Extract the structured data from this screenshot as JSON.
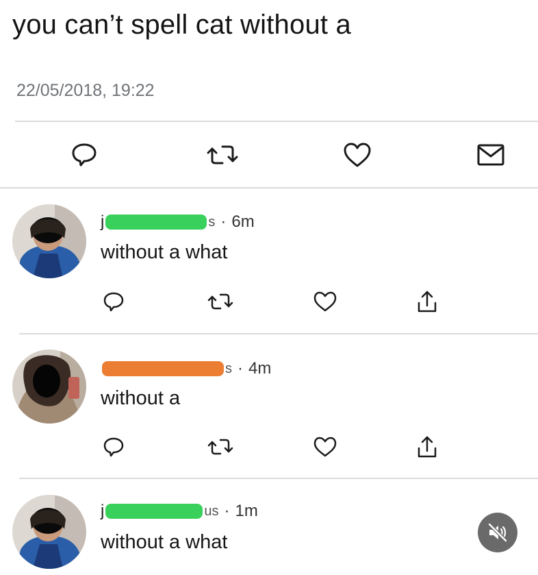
{
  "tweet": {
    "text": "you can’t spell cat without a",
    "timestamp": "22/05/2018, 19:22",
    "actions": {
      "reply_icon": "reply-icon",
      "retweet_icon": "retweet-icon",
      "like_icon": "heart-icon",
      "message_icon": "envelope-icon"
    }
  },
  "replies": [
    {
      "name_start": "j",
      "name_end": "s",
      "redaction_color": "#39d15b",
      "time": "6m",
      "text": "without a what"
    },
    {
      "name_start": "",
      "name_end": "s",
      "redaction_color": "#ec7e34",
      "time": "4m",
      "text": "without a"
    },
    {
      "name_start": "j",
      "name_end": "us",
      "redaction_color": "#39d15b",
      "time": "1m",
      "text": "without a what"
    }
  ],
  "mute_button": {
    "icon": "speaker-muted-icon"
  },
  "colors": {
    "divider": "#d8dadc",
    "icon_stroke": "#1a1a1a",
    "mute_bg": "#6a6a6a"
  }
}
